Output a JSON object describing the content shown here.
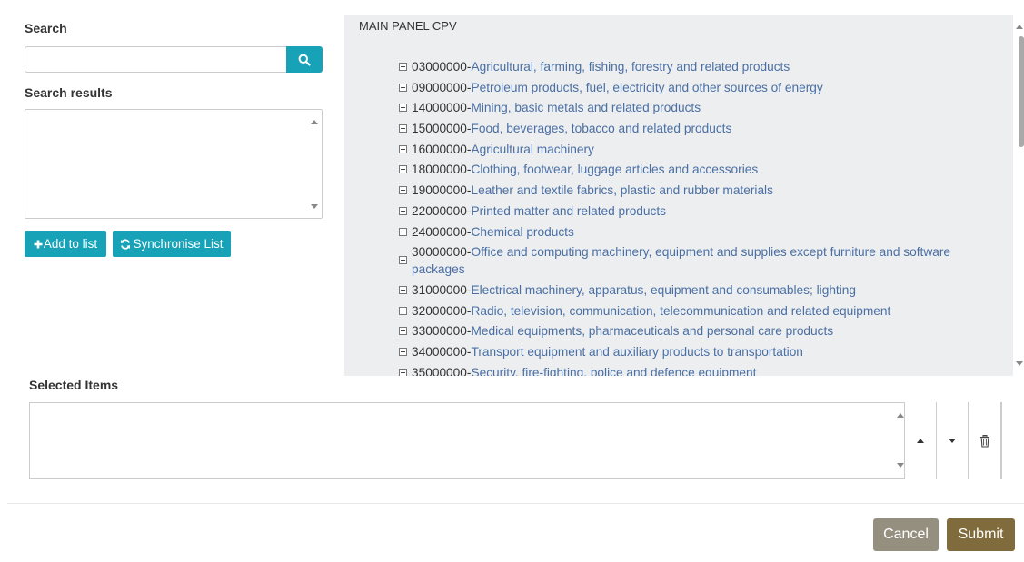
{
  "search": {
    "label": "Search",
    "input_value": "",
    "placeholder": "",
    "button_icon": "search-icon"
  },
  "results": {
    "label": "Search results",
    "add_to_list_label": "Add to list",
    "synchronise_label": "Synchronise List"
  },
  "tree": {
    "title": "MAIN PANEL CPV",
    "items": [
      {
        "code": "03000000",
        "name": "Agricultural, farming, fishing, forestry and related products"
      },
      {
        "code": "09000000",
        "name": "Petroleum products, fuel, electricity and other sources of energy"
      },
      {
        "code": "14000000",
        "name": "Mining, basic metals and related products"
      },
      {
        "code": "15000000",
        "name": "Food, beverages, tobacco and related products"
      },
      {
        "code": "16000000",
        "name": "Agricultural machinery"
      },
      {
        "code": "18000000",
        "name": "Clothing, footwear, luggage articles and accessories"
      },
      {
        "code": "19000000",
        "name": "Leather and textile fabrics, plastic and rubber materials"
      },
      {
        "code": "22000000",
        "name": "Printed matter and related products"
      },
      {
        "code": "24000000",
        "name": "Chemical products"
      },
      {
        "code": "30000000",
        "name": "Office and computing machinery, equipment and supplies except furniture and software packages"
      },
      {
        "code": "31000000",
        "name": "Electrical machinery, apparatus, equipment and consumables; lighting"
      },
      {
        "code": "32000000",
        "name": "Radio, television, communication, telecommunication and related equipment"
      },
      {
        "code": "33000000",
        "name": "Medical equipments, pharmaceuticals and personal care products"
      },
      {
        "code": "34000000",
        "name": "Transport equipment and auxiliary products to transportation"
      },
      {
        "code": "35000000",
        "name": "Security, fire-fighting, police and defence equipment"
      }
    ]
  },
  "selected": {
    "label": "Selected Items"
  },
  "footer": {
    "cancel_label": "Cancel",
    "submit_label": "Submit"
  },
  "colors": {
    "teal": "#17a2b8",
    "link": "#4a6fa5",
    "cancel": "#958f7f",
    "submit": "#7f6b3c",
    "panel_bg": "#eceeef"
  }
}
